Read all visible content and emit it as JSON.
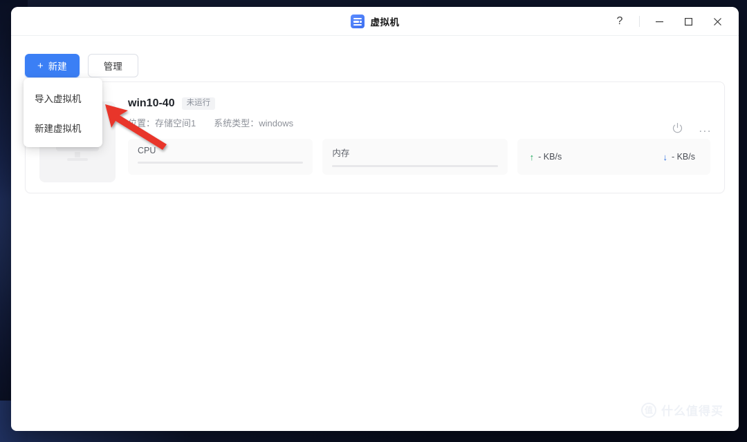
{
  "window": {
    "title": "虚拟机",
    "app_icon": "list-icon",
    "controls": {
      "help": "?",
      "minimize": "minimize-icon",
      "maximize": "maximize-icon",
      "close": "close-icon"
    }
  },
  "toolbar": {
    "new_button": "新建",
    "new_button_plus": "+",
    "manage_button": "管理"
  },
  "dropdown": {
    "items": [
      {
        "label": "导入虚拟机"
      },
      {
        "label": "新建虚拟机"
      }
    ]
  },
  "vm_card": {
    "name": "win10-40",
    "status_badge": "未运行",
    "location_label": "位置：",
    "location_value": "存储空间1",
    "system_label": "系统类型：",
    "system_value": "windows",
    "stats": [
      {
        "label": "CPU",
        "progress": 0
      },
      {
        "label": "内存",
        "progress": 0
      }
    ],
    "network": {
      "upload": "- KB/s",
      "download": "- KB/s",
      "upload_icon": "arrow-up-icon",
      "download_icon": "arrow-down-icon"
    },
    "actions": {
      "power": "power-icon",
      "more": "..."
    }
  },
  "watermark": {
    "logo": "值",
    "text": "什么值得买"
  },
  "colors": {
    "primary": "#3b7ff5",
    "upload": "#19a657",
    "download": "#2d6fe0",
    "annotation": "#e8352b",
    "badge_bg": "#f2f3f5"
  }
}
